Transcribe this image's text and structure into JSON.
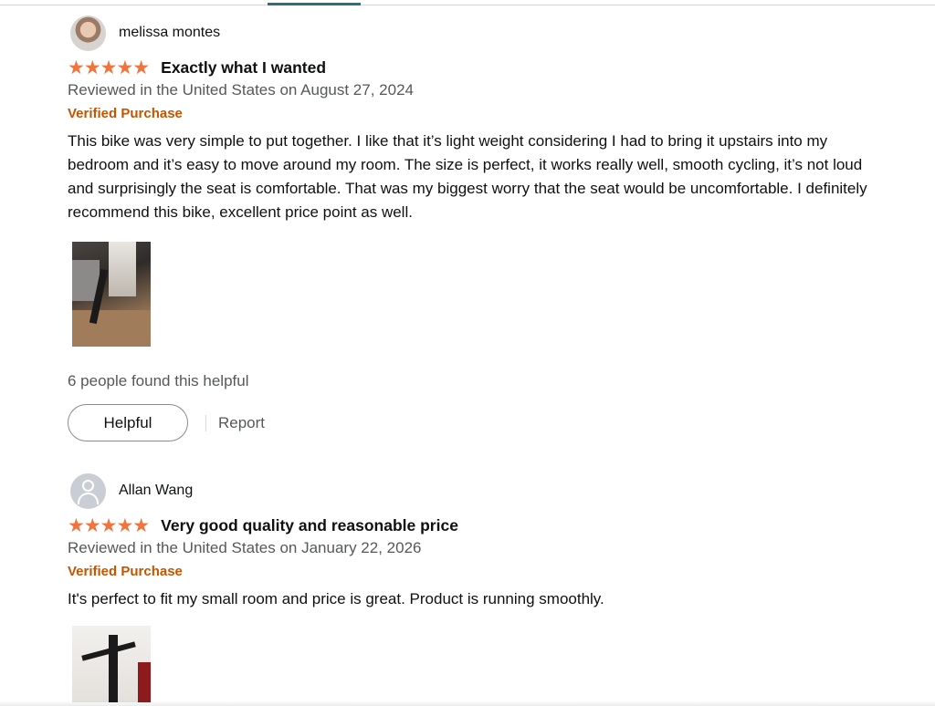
{
  "reviews": [
    {
      "reviewer_name": "melissa montes",
      "stars": "★★★★★",
      "rating": 5,
      "title": "Exactly what I wanted",
      "date": "Reviewed in the United States on August 27, 2024",
      "verified": "Verified Purchase",
      "body": "This bike was very simple to put together. I like that it’s light weight considering I had to bring it upstairs into my bedroom and it’s easy to move around my room. The size is perfect, it works really well, smooth cycling, it’s not loud and surprisingly the seat is comfortable. That was my biggest worry that the seat would be uncomfortable. I definitely recommend this bike, excellent price point as well.",
      "helpful_count": "6 people found this helpful",
      "helpful_label": "Helpful",
      "report_label": "Report"
    },
    {
      "reviewer_name": "Allan Wang",
      "stars": "★★★★★",
      "rating": 5,
      "title": "Very good quality and reasonable price",
      "date": "Reviewed in the United States on January 22, 2026",
      "verified": "Verified Purchase",
      "body": "It's perfect to fit my small room and price is great. Product is running smoothly."
    }
  ],
  "colors": {
    "star": "#f0743e",
    "verified": "#c45500",
    "muted_text": "#565959",
    "tab_indicator": "#2a6f7f"
  },
  "icons": {
    "star": "star-icon",
    "default_avatar": "user-avatar-icon"
  }
}
